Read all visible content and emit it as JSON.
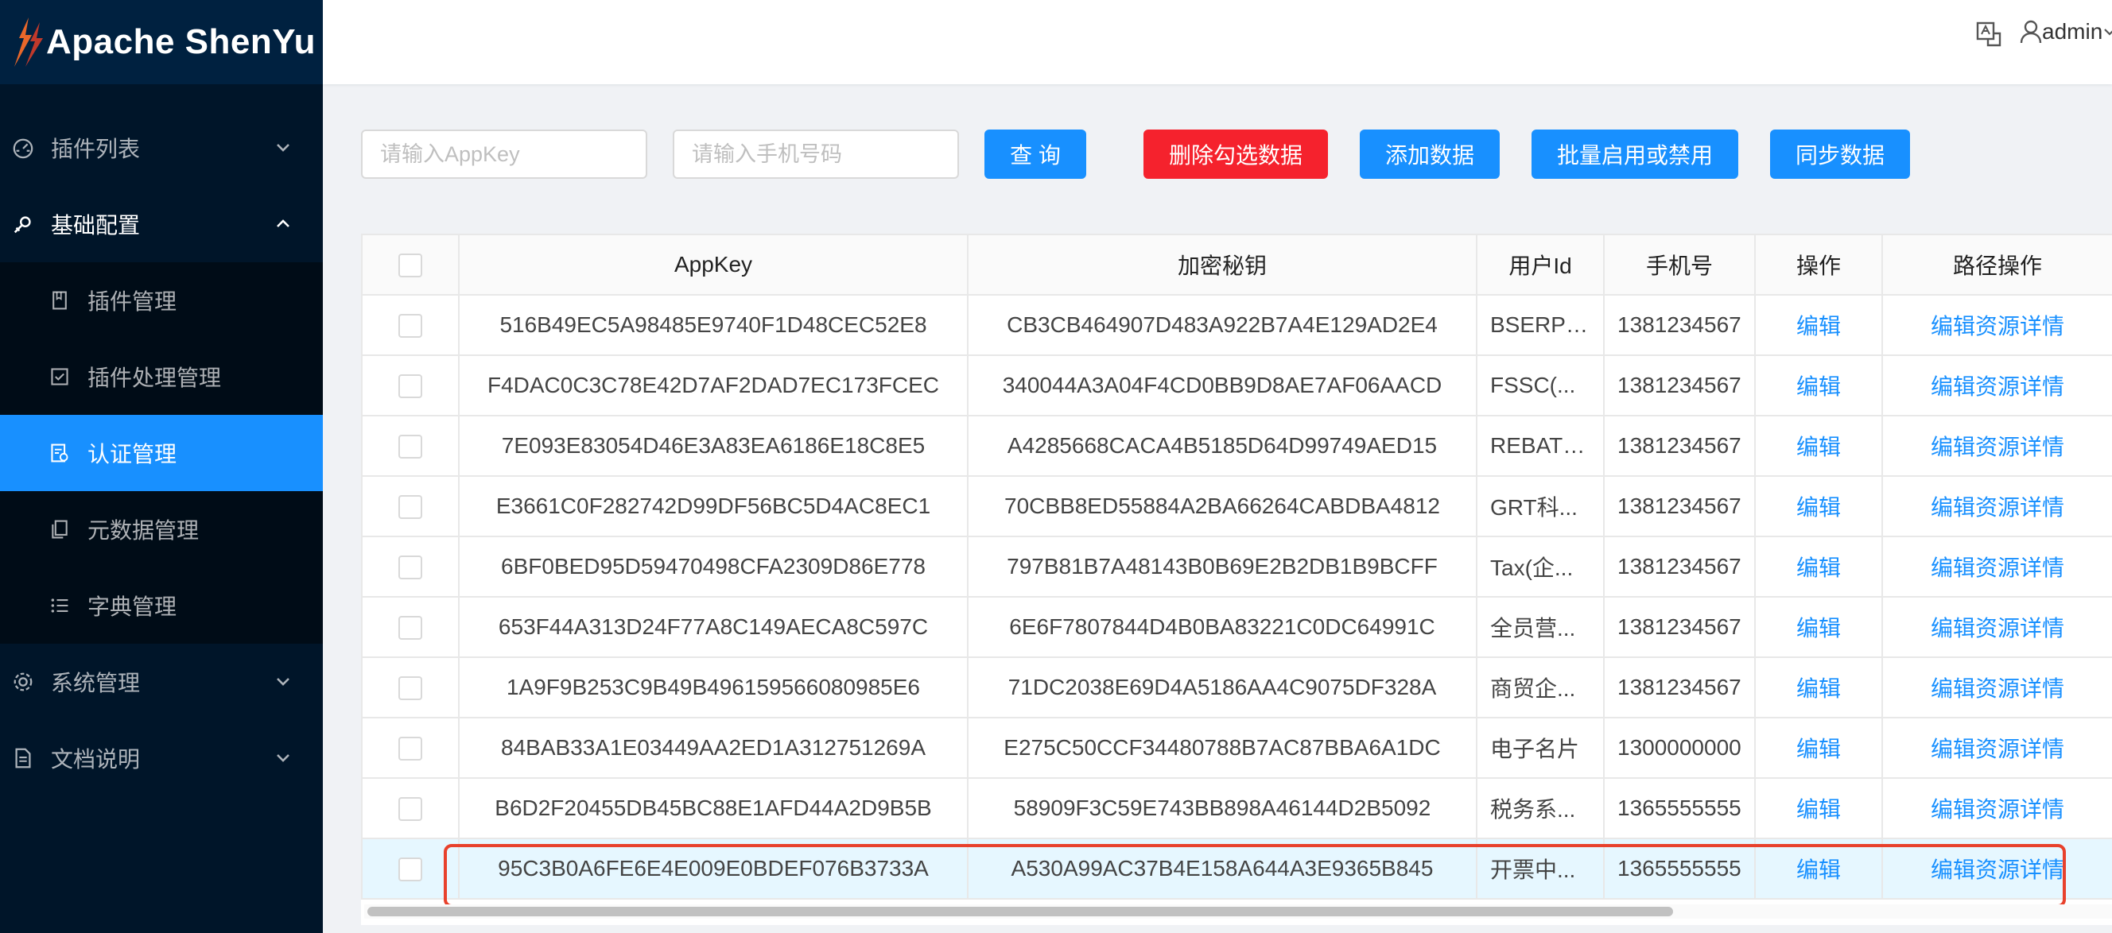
{
  "app": {
    "title": "Apache ShenYu"
  },
  "sidebar": {
    "items": [
      {
        "label": "插件列表",
        "icon": "dashboard-icon"
      },
      {
        "label": "基础配置",
        "icon": "setting-icon"
      },
      {
        "label": "插件管理",
        "icon": "book-icon"
      },
      {
        "label": "插件处理管理",
        "icon": "check-square-icon"
      },
      {
        "label": "认证管理",
        "icon": "audit-icon"
      },
      {
        "label": "元数据管理",
        "icon": "snippets-icon"
      },
      {
        "label": "字典管理",
        "icon": "unordered-list-icon"
      },
      {
        "label": "系统管理",
        "icon": "gear-icon"
      },
      {
        "label": "文档说明",
        "icon": "file-text-icon"
      }
    ]
  },
  "header": {
    "user": "admin"
  },
  "toolbar": {
    "appkey_placeholder": "请输入AppKey",
    "phone_placeholder": "请输入手机号码",
    "query_label": "查 询",
    "delete_label": "删除勾选数据",
    "add_label": "添加数据",
    "batch_label": "批量启用或禁用",
    "sync_label": "同步数据"
  },
  "table": {
    "headers": {
      "appkey": "AppKey",
      "secret": "加密秘钥",
      "userid": "用户Id",
      "phone": "手机号",
      "ops": "操作",
      "path_ops": "路径操作"
    },
    "edit_label": "编辑",
    "path_edit_label": "编辑资源详情",
    "rows": [
      {
        "appkey": "516B49EC5A98485E9740F1D48CEC52E8",
        "secret": "CB3CB464907D483A922B7A4E129AD2E4",
        "userid": "BSERP(...",
        "phone": "1381234567"
      },
      {
        "appkey": "F4DAC0C3C78E42D7AF2DAD7EC173FCEC",
        "secret": "340044A3A04F4CD0BB9D8AE7AF06AACD",
        "userid": "FSSC(...",
        "phone": "1381234567"
      },
      {
        "appkey": "7E093E83054D46E3A83EA6186E18C8E5",
        "secret": "A4285668CACA4B5185D64D99749AED15",
        "userid": "REBATE...",
        "phone": "1381234567"
      },
      {
        "appkey": "E3661C0F282742D99DF56BC5D4AC8EC1",
        "secret": "70CBB8ED55884A2BA66264CABDBA4812",
        "userid": "GRT科...",
        "phone": "1381234567"
      },
      {
        "appkey": "6BF0BED95D59470498CFA2309D86E778",
        "secret": "797B81B7A48143B0B69E2B2DB1B9BCFF",
        "userid": "Tax(企...",
        "phone": "1381234567"
      },
      {
        "appkey": "653F44A313D24F77A8C149AECA8C597C",
        "secret": "6E6F7807844D4B0BA83221C0DC64991C",
        "userid": "全员营...",
        "phone": "1381234567"
      },
      {
        "appkey": "1A9F9B253C9B49B496159566080985E6",
        "secret": "71DC2038E69D4A5186AA4C9075DF328A",
        "userid": "商贸企...",
        "phone": "1381234567"
      },
      {
        "appkey": "84BAB33A1E03449AA2ED1A312751269A",
        "secret": "E275C50CCF34480788B7AC87BBA6A1DC",
        "userid": "电子名片",
        "phone": "1300000000"
      },
      {
        "appkey": "B6D2F20455DB45BC88E1AFD44A2D9B5B",
        "secret": "58909F3C59E743BB898A46144D2B5092",
        "userid": "税务系...",
        "phone": "1365555555"
      },
      {
        "appkey": "95C3B0A6FE6E4E009E0BDEF076B3733A",
        "secret": "A530A99AC37B4E158A644A3E9365B845",
        "userid": "开票中...",
        "phone": "1365555555"
      }
    ]
  }
}
